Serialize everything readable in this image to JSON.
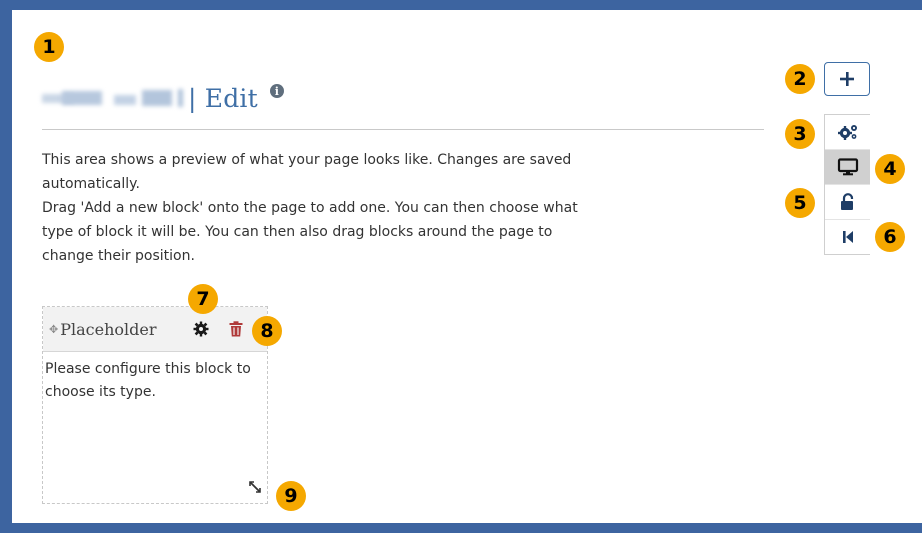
{
  "header": {
    "title": "| Edit",
    "info_icon": "info-circle-icon"
  },
  "instructions": [
    "This area shows a preview of what your page looks like. Changes are saved automatically.",
    "Drag 'Add a new block' onto the page to add one. You can then choose what type of block it will be. You can then also drag blocks around the page to change their position."
  ],
  "toolbar": {
    "add_icon": "plus-icon",
    "buttons": [
      {
        "icon": "gears-icon"
      },
      {
        "icon": "monitor-icon",
        "active": true
      },
      {
        "icon": "unlock-icon"
      },
      {
        "icon": "skip-back-icon"
      }
    ]
  },
  "block": {
    "title": "Placeholder",
    "body": "Please configure this block to choose its type."
  },
  "callouts": [
    "1",
    "2",
    "3",
    "4",
    "5",
    "6",
    "7",
    "8",
    "9"
  ],
  "colors": {
    "frame": "#3d64a0",
    "accent": "#3f6fa6",
    "callout": "#f5a800",
    "delete": "#b03a3a"
  }
}
